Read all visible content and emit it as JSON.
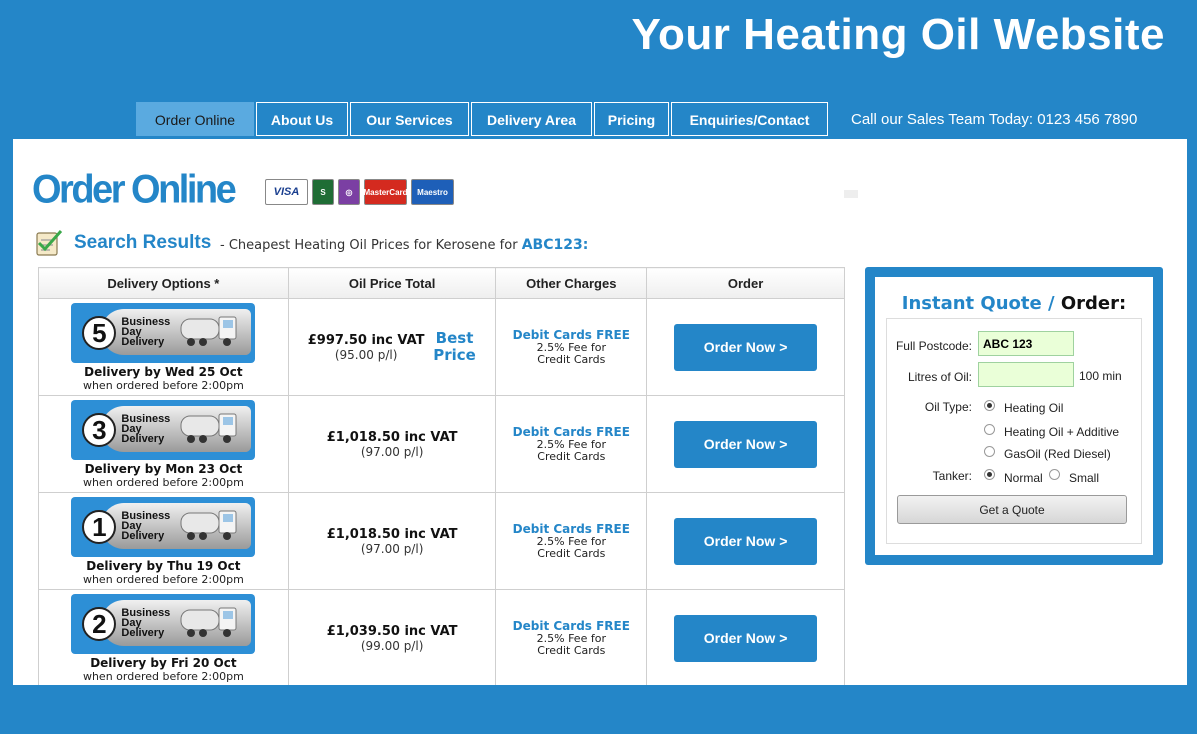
{
  "site_title": "Your Heating Oil Website",
  "nav": [
    "Order Online",
    "About Us",
    "Our Services",
    "Delivery Area",
    "Pricing",
    "Enquiries/Contact"
  ],
  "sales_text": "Call our Sales Team Today: 0123 456 7890",
  "order_heading": "Order Online",
  "cards": [
    "VISA",
    "SWITCH",
    "SOLO",
    "MasterCard",
    "Maestro"
  ],
  "search": {
    "title": "Search Results",
    "subtitle": "- Cheapest Heating Oil Prices for Kerosene for",
    "postcode": "ABC123:"
  },
  "table": {
    "headers": [
      "Delivery Options *",
      "Oil Price Total",
      "Other Charges",
      "Order"
    ],
    "banner_text": [
      "Business",
      "Day",
      "Delivery"
    ],
    "rows": [
      {
        "days": "5",
        "delivery": "Delivery by Wed 25 Oct",
        "cutoff": "when ordered before 2:00pm",
        "price": "£997.50 inc VAT",
        "ppl": "(95.00 p/l)",
        "badge": "Best Price",
        "debit": "Debit Cards FREE",
        "fee1": "2.5% Fee for",
        "fee2": "Credit Cards",
        "button": "Order Now >"
      },
      {
        "days": "3",
        "delivery": "Delivery by Mon 23 Oct",
        "cutoff": "when ordered before 2:00pm",
        "price": "£1,018.50 inc VAT",
        "ppl": "(97.00 p/l)",
        "badge": "",
        "debit": "Debit Cards FREE",
        "fee1": "2.5% Fee for",
        "fee2": "Credit Cards",
        "button": "Order Now >"
      },
      {
        "days": "1",
        "delivery": "Delivery by Thu 19 Oct",
        "cutoff": "when ordered before 2:00pm",
        "price": "£1,018.50 inc VAT",
        "ppl": "(97.00 p/l)",
        "badge": "",
        "debit": "Debit Cards FREE",
        "fee1": "2.5% Fee for",
        "fee2": "Credit Cards",
        "button": "Order Now >"
      },
      {
        "days": "2",
        "delivery": "Delivery by Fri 20 Oct",
        "cutoff": "when ordered before 2:00pm",
        "price": "£1,039.50 inc VAT",
        "ppl": "(99.00 p/l)",
        "badge": "",
        "debit": "Debit Cards FREE",
        "fee1": "2.5% Fee for",
        "fee2": "Credit Cards",
        "button": "Order Now >"
      }
    ]
  },
  "quote": {
    "title_a": "Instant Quote /",
    "title_b": "Order:",
    "postcode_label": "Full Postcode:",
    "postcode_value": "ABC 123",
    "litres_label": "Litres of Oil:",
    "litres_value": "",
    "litres_min": "100 min",
    "oil_type_label": "Oil Type:",
    "oil_types": [
      "Heating Oil",
      "Heating Oil + Additive",
      "GasOil (Red Diesel)"
    ],
    "oil_type_selected": "Heating Oil",
    "tanker_label": "Tanker:",
    "tankers": [
      "Normal",
      "Small"
    ],
    "tanker_selected": "Normal",
    "button": "Get a Quote"
  },
  "colors": {
    "brand_blue": "#2486c8",
    "input_bg": "#eaffd8"
  }
}
